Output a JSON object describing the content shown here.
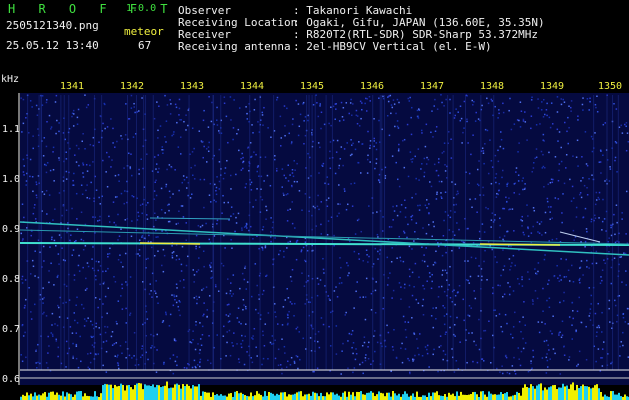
{
  "header": {
    "app_title": "H R O F F T",
    "version": "1.0.0",
    "filename": "2505121340.png",
    "datetime": "25.05.12 13:40",
    "meteor_label": "meteor",
    "meteor_count": "67"
  },
  "info": {
    "labels": [
      "Observer",
      "Receiving Location",
      "Receiver",
      "Receiving antenna"
    ],
    "values": [
      ": Takanori Kawachi",
      ": Ogaki, Gifu, JAPAN (136.60E, 35.35N)",
      ": R820T2(RTL-SDR) SDR-Sharp 53.372MHz",
      ": 2el-HB9CV Vertical (el. E-W)"
    ]
  },
  "spectrogram": {
    "unit_label": "kHz",
    "time_ticks": [
      "1341",
      "1342",
      "1343",
      "1344",
      "1345",
      "1346",
      "1347",
      "1348",
      "1349",
      "1350"
    ],
    "freq_ticks": [
      "1.1",
      "1.0",
      "0.9",
      "0.8",
      "0.7",
      "0.6"
    ],
    "colors": {
      "background": "#000000",
      "noise": "#1a2aa0",
      "signal": "#40e0d0",
      "histogram_yellow": "#f0f000",
      "histogram_cyan": "#20d0f0"
    }
  }
}
